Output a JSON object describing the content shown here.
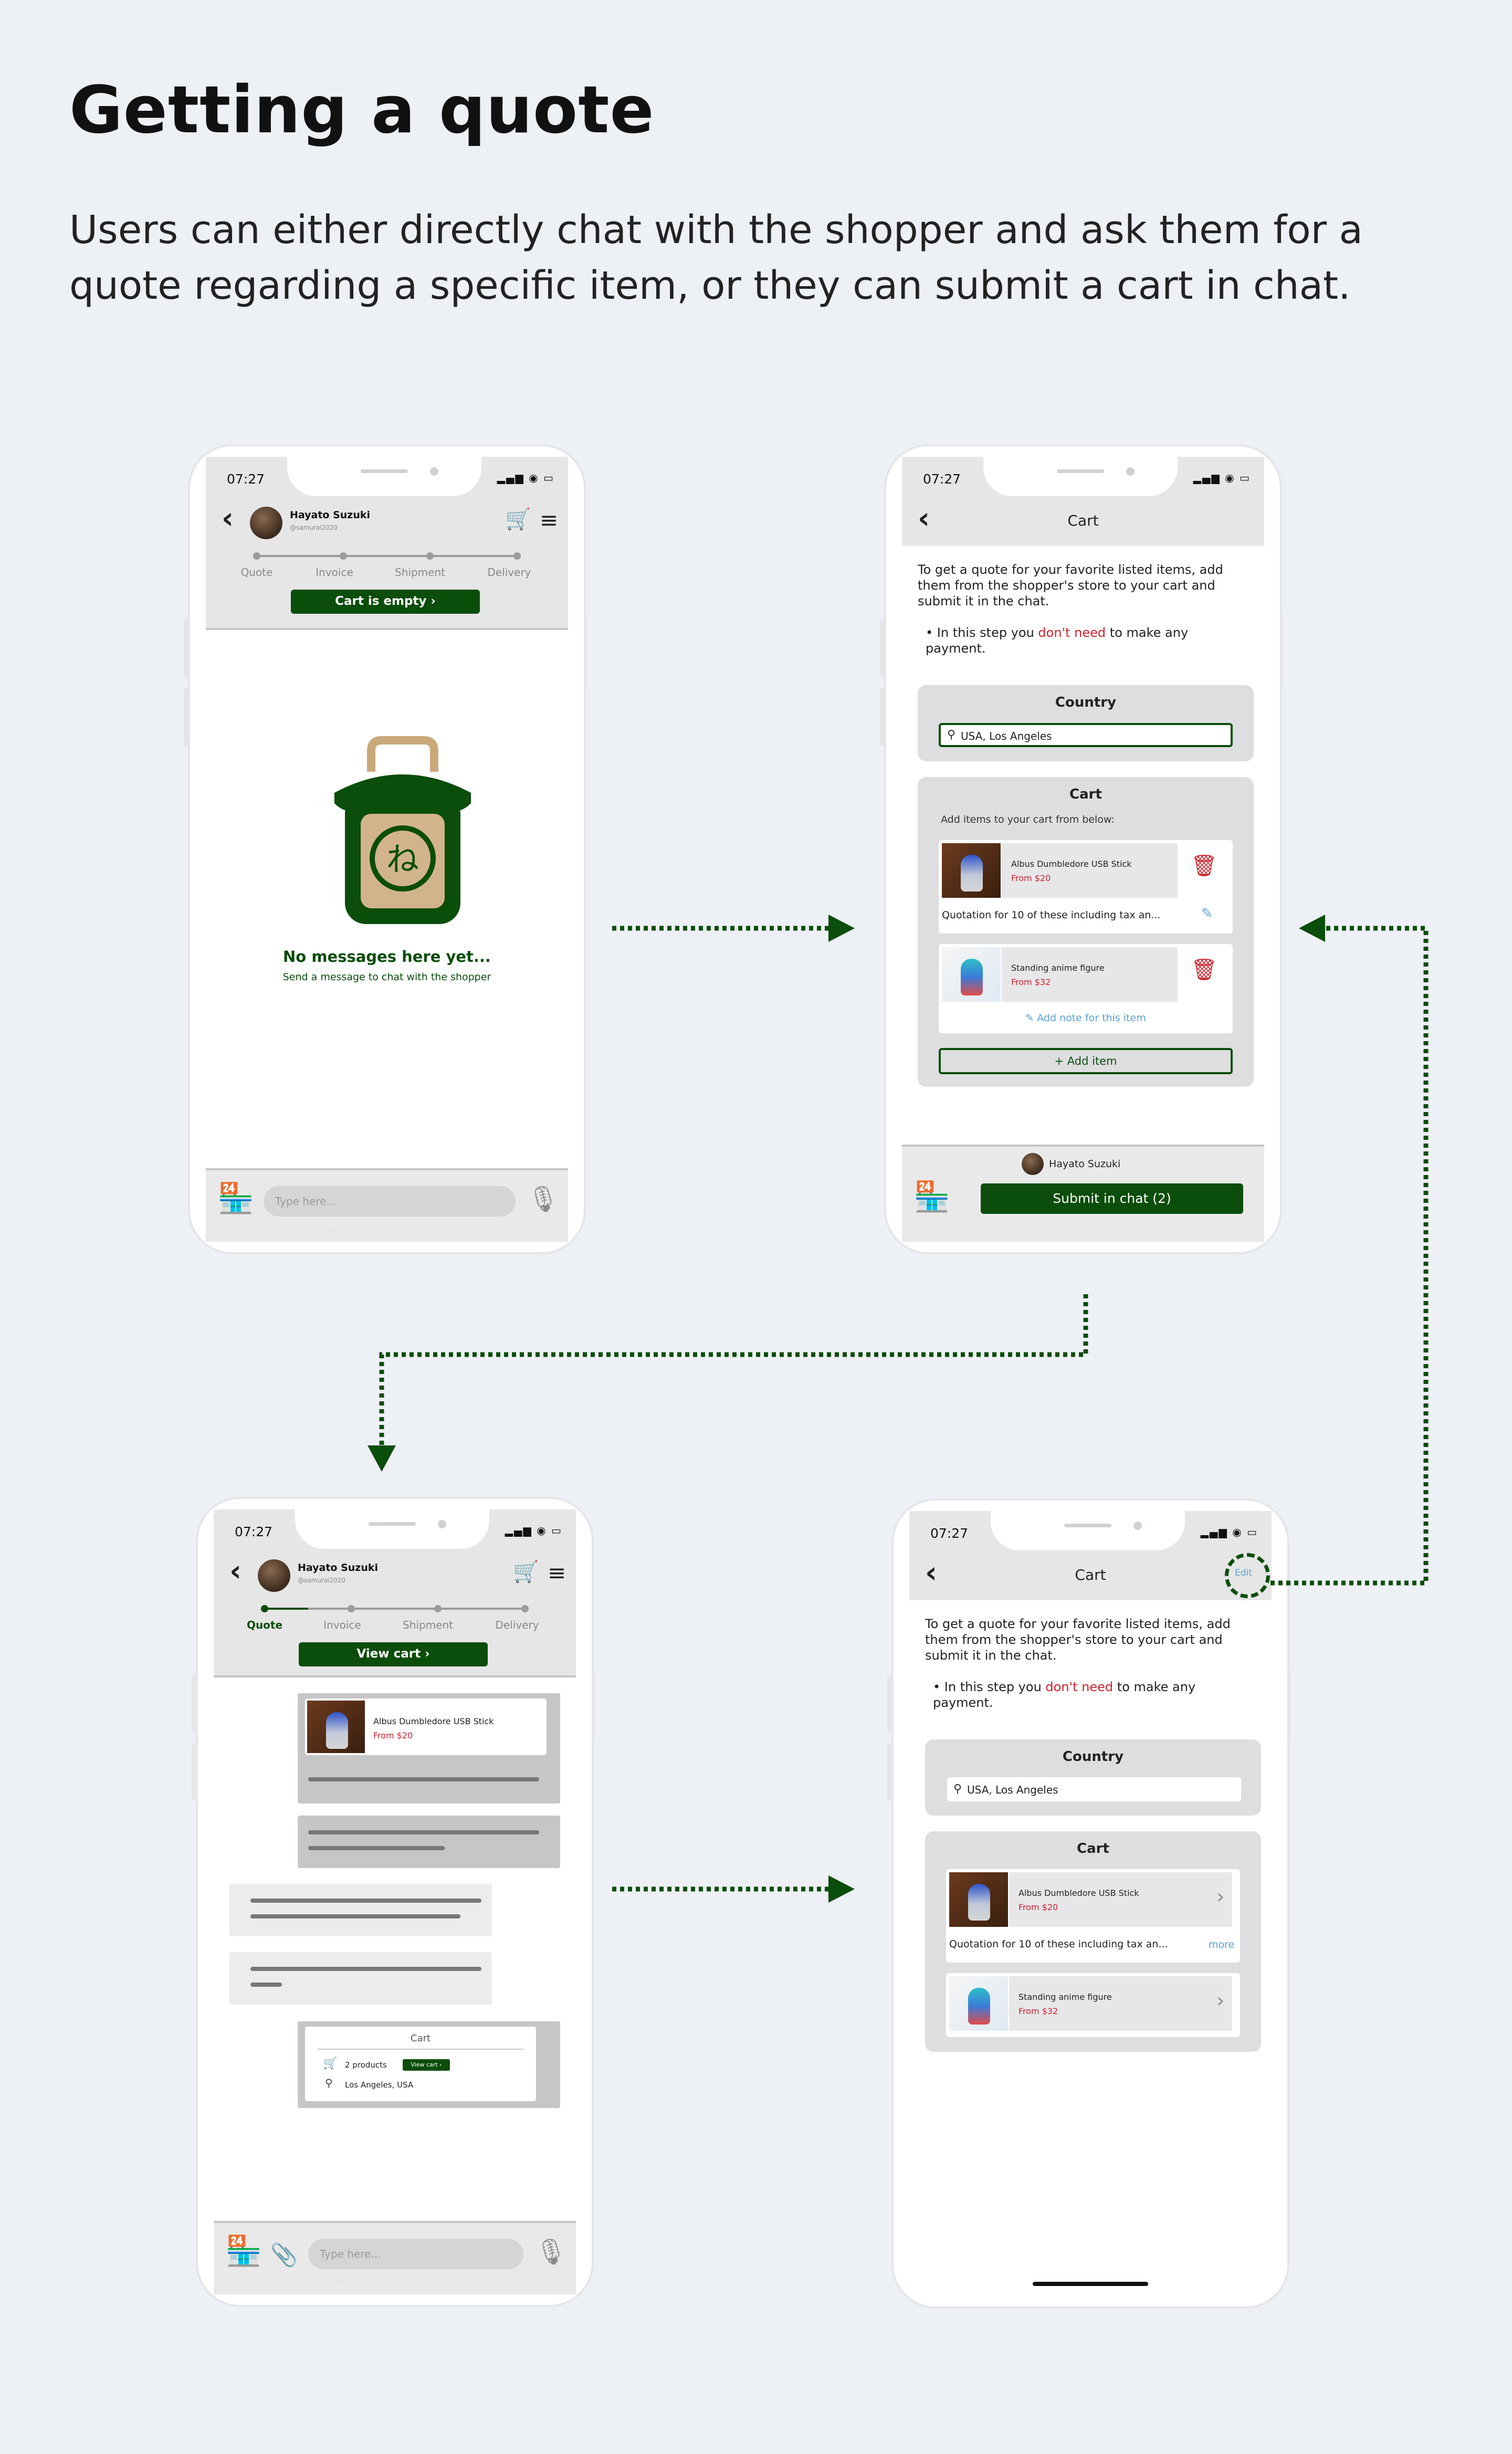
{
  "heading": "Getting a quote",
  "intro": "Users can either directly chat with the shopper and ask them for a quote regarding a specific item, or they can submit a cart in chat.",
  "status_time": "07:27",
  "status_icons": "▂▄▆ ◉ ▭",
  "icons": {
    "back": "‹",
    "cart": "🛒",
    "menu": "≡",
    "store": "🏪",
    "mic": "🎙",
    "pin": "⚲",
    "trash": "🗑",
    "edit": "✎",
    "clip": "📎",
    "chevron": "›"
  },
  "user": {
    "name": "Hayato Suzuki",
    "handle": "@samurai2020"
  },
  "steps": [
    "Quote",
    "Invoice",
    "Shipment",
    "Delivery"
  ],
  "chat_empty": {
    "cart_button": "Cart is empty  ›",
    "empty_title": "No messages here yet...",
    "empty_sub": "Send a message to chat with the shopper",
    "input_placeholder": "Type here..."
  },
  "cart_screen": {
    "title": "Cart",
    "desc": "To get a quote for your favorite listed items, add them from the shopper's store to your cart and submit it in the chat.",
    "bullet_pre": "In this step you ",
    "bullet_red": "don't need",
    "bullet_post": " to make any payment.",
    "country_title": "Country",
    "location": "USA, Los Angeles",
    "cart_title": "Cart",
    "add_hint": "Add items to your cart from below:",
    "items": [
      {
        "name": "Albus Dumbledore USB Stick",
        "price": "From $20",
        "note": "Quotation for 10 of these including tax an..."
      },
      {
        "name": "Standing anime figure",
        "price": "From $32",
        "note": "Add note for this item"
      }
    ],
    "add_item": "+ Add item",
    "submit_user": "Hayato Suzuki",
    "submit_button": "Submit in chat  (2)",
    "edit": "Edit",
    "more": "more"
  },
  "chat_cart": {
    "view_cart": "View cart  ›",
    "item_name": "Albus Dumbledore USB Stick",
    "item_price": "From $20",
    "cart_card_title": "Cart",
    "products": "2 products",
    "view_cart_small": "View cart ›",
    "location": "Los Angeles, USA",
    "input_placeholder": "Type here..."
  },
  "colors": {
    "brand_green": "#0b4d0b",
    "accent_red": "#d0212c",
    "link_blue": "#5aa0d6",
    "background": "#edf0f4"
  }
}
